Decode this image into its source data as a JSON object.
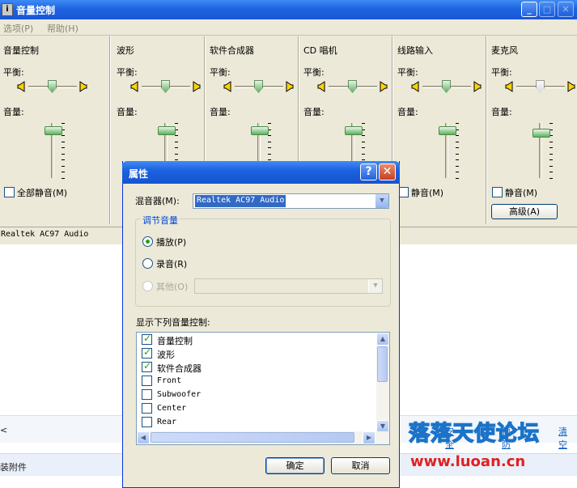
{
  "main_window": {
    "title": "音量控制",
    "title_icon_glyph": "i",
    "menu": [
      "选项(P)",
      "帮助(H)"
    ],
    "channels": [
      {
        "name": "音量控制",
        "balance_label": "平衡:",
        "volume_label": "音量:",
        "mute_label": "全部静音(M)",
        "volume_level": 0.9,
        "balance_style": "green"
      },
      {
        "name": "波形",
        "balance_label": "平衡:",
        "volume_label": "音量:",
        "mute_label": "",
        "volume_level": 0.9,
        "balance_style": "green"
      },
      {
        "name": "软件合成器",
        "balance_label": "平衡:",
        "volume_label": "音量:",
        "mute_label": "",
        "volume_level": 0.9,
        "balance_style": "green"
      },
      {
        "name": "CD 唱机",
        "balance_label": "平衡:",
        "volume_label": "音量:",
        "mute_label": "",
        "volume_level": 0.9,
        "balance_style": "green"
      },
      {
        "name": "线路输入",
        "balance_label": "平衡:",
        "volume_label": "音量:",
        "mute_label": "静音(M)",
        "volume_level": 0.9,
        "balance_style": "green"
      },
      {
        "name": "麦克风",
        "balance_label": "平衡:",
        "volume_label": "音量:",
        "mute_label": "静音(M)",
        "volume_level": 0.85,
        "balance_style": "grey"
      }
    ],
    "advanced_button": "高级(A)",
    "status": "Realtek AC97 Audio"
  },
  "properties_dialog": {
    "title": "属性",
    "help_glyph": "?",
    "close_glyph": "✕",
    "mixer_label": "混音器(M):",
    "mixer_value": "Realtek AC97 Audio",
    "group_title": "调节音量",
    "radio_playback": "播放(P)",
    "radio_record": "录音(R)",
    "radio_other": "其他(O)",
    "list_title": "显示下列音量控制:",
    "list_items": [
      {
        "label": "音量控制",
        "checked": true
      },
      {
        "label": "波形",
        "checked": true
      },
      {
        "label": "软件合成器",
        "checked": true
      },
      {
        "label": "Front",
        "checked": false
      },
      {
        "label": "Subwoofer",
        "checked": false
      },
      {
        "label": "Center",
        "checked": false
      },
      {
        "label": "Rear",
        "checked": false
      }
    ],
    "ok_button": "确定",
    "cancel_button": "取消"
  },
  "background": {
    "links": [
      "安全检查",
      "预防补丁",
      "清空"
    ],
    "attachment_text": "装附件",
    "watermark": "落落天使论坛",
    "watermark_url": "www.luoan.cn"
  },
  "colors": {
    "titlebar": "#1f64e0",
    "face": "#ece9d8",
    "check_green": "#21a121",
    "watermark_url": "#e02020"
  }
}
